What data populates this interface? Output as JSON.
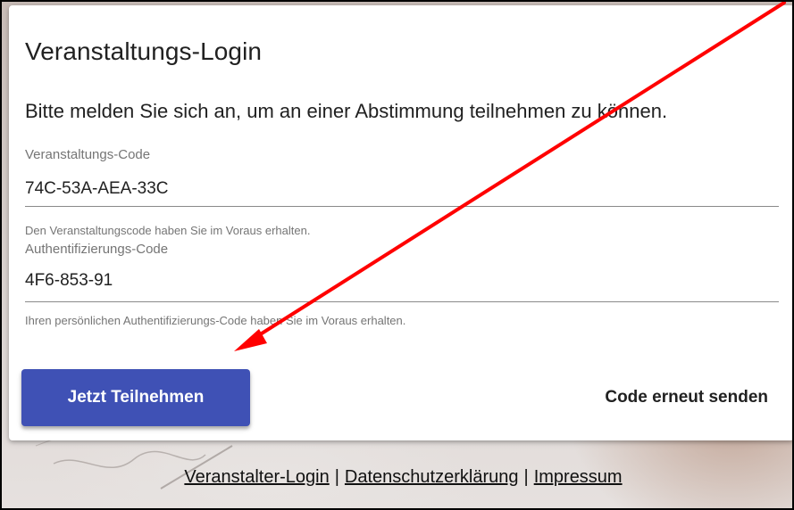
{
  "card": {
    "title": "Veranstaltungs-Login",
    "subtitle": "Bitte melden Sie sich an, um an einer Abstimmung teilnehmen zu können."
  },
  "event_code": {
    "label": "Veranstaltungs-Code",
    "value": "74C-53A-AEA-33C",
    "helper": "Den Veranstaltungscode haben Sie im Voraus erhalten."
  },
  "auth_code": {
    "label": "Authentifizierungs-Code",
    "value": "4F6-853-91",
    "helper": "Ihren persönlichen Authentifizierungs-Code haben Sie im Voraus erhalten."
  },
  "actions": {
    "submit_label": "Jetzt Teilnehmen",
    "resend_label": "Code erneut senden"
  },
  "footer": {
    "links": [
      "Veranstalter-Login",
      "Datenschutzerklärung",
      "Impressum"
    ],
    "separator": "|"
  },
  "colors": {
    "primary": "#3f51b5",
    "annotation_arrow": "#ff0000"
  }
}
